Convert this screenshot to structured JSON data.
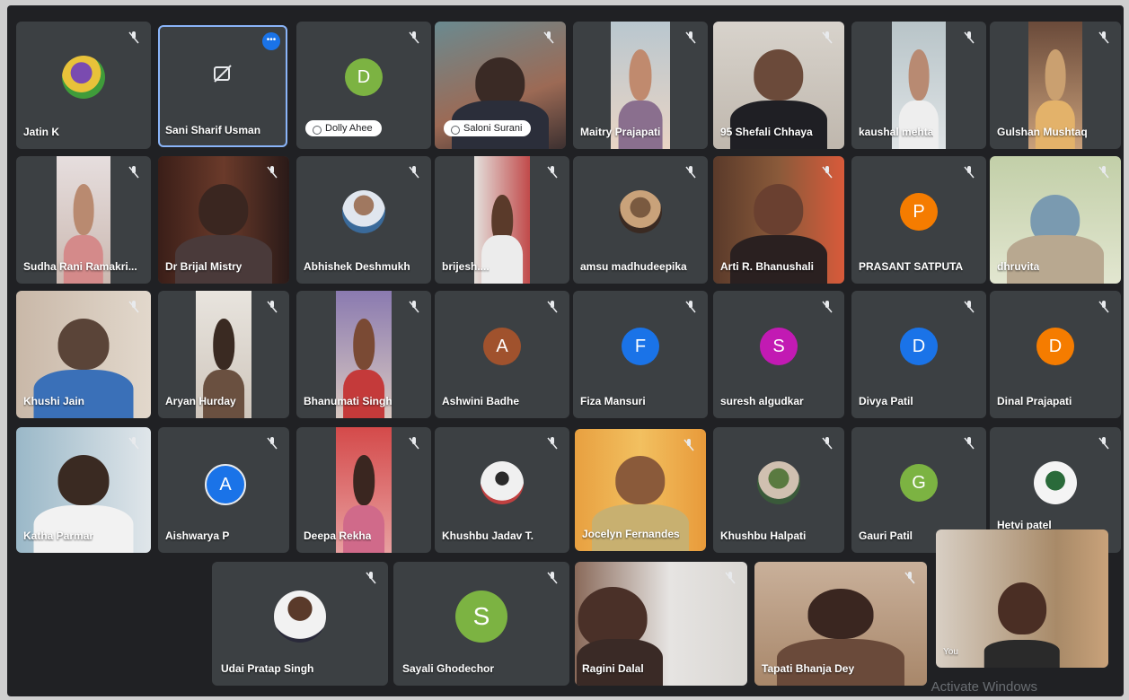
{
  "meeting": {
    "watermark": "Activate Windows",
    "participants_row1": [
      {
        "name": "Jatin K"
      },
      {
        "name": "Sani Sharif Usman"
      },
      {
        "name": "Dolly Ahee",
        "initial": "D"
      },
      {
        "name": "Saloni Surani"
      },
      {
        "name": "Maitry Prajapati"
      },
      {
        "name": "95 Shefali Chhaya"
      },
      {
        "name": "kaushal mehta"
      },
      {
        "name": "Gulshan Mushtaq"
      }
    ],
    "participants_row2": [
      {
        "name": "Sudha Rani Ramakri..."
      },
      {
        "name": "Dr Brijal Mistry"
      },
      {
        "name": "Abhishek Deshmukh"
      },
      {
        "name": "brijesh...."
      },
      {
        "name": "amsu madhudeepika"
      },
      {
        "name": "Arti R. Bhanushali"
      },
      {
        "name": "PRASANT SATPUTA",
        "initial": "P"
      },
      {
        "name": "dhruvita"
      }
    ],
    "participants_row3": [
      {
        "name": "Khushi Jain"
      },
      {
        "name": "Aryan Hurday"
      },
      {
        "name": "Bhanumati Singh"
      },
      {
        "name": "Ashwini Badhe",
        "initial": "A"
      },
      {
        "name": "Fiza Mansuri",
        "initial": "F"
      },
      {
        "name": "suresh algudkar",
        "initial": "S"
      },
      {
        "name": "Divya Patil",
        "initial": "D"
      },
      {
        "name": "Dinal Prajapati",
        "initial": "D"
      }
    ],
    "participants_row4": [
      {
        "name": "Katha Parmar"
      },
      {
        "name": "Aishwarya P",
        "initial": "A"
      },
      {
        "name": "Deepa Rekha"
      },
      {
        "name": "Khushbu Jadav T."
      },
      {
        "name": "Jocelyn Fernandes"
      },
      {
        "name": "Khushbu Halpati"
      },
      {
        "name": "Gauri Patil",
        "initial": "G"
      },
      {
        "name": "Hetvi patel"
      }
    ],
    "participants_row5": [
      {
        "name": "Udai Pratap Singh"
      },
      {
        "name": "Sayali Ghodechor",
        "initial": "S"
      },
      {
        "name": "Ragini Dalal"
      },
      {
        "name": "Tapati Bhanja Dey"
      },
      {
        "name": "You"
      }
    ],
    "colors": {
      "tile": "#3c4043",
      "bg": "#202124",
      "active_outline": "#8ab4f8",
      "green": "#7cb342",
      "orange": "#f57c00",
      "blue": "#1a73e8",
      "brown": "#a0522d",
      "purple": "#c21ab3"
    }
  }
}
